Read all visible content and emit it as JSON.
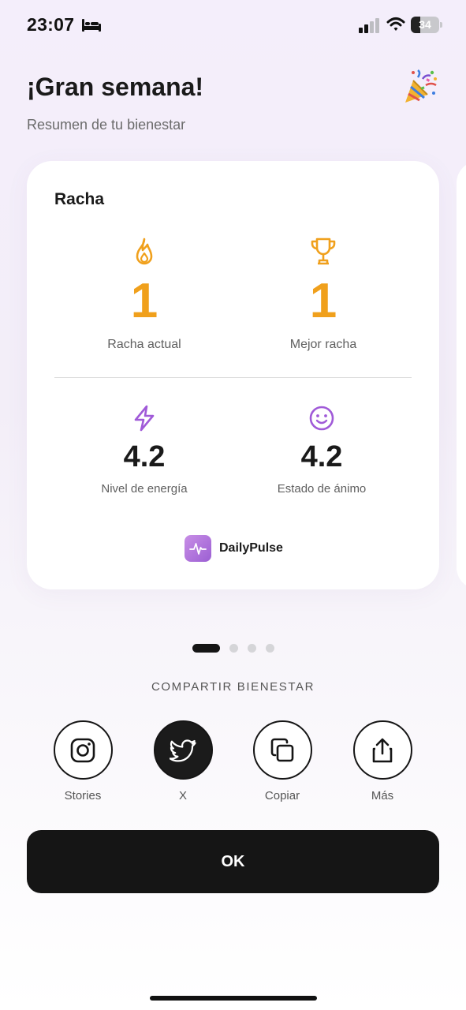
{
  "status_bar": {
    "time": "23:07",
    "battery_level": "34",
    "battery_fraction": 0.34,
    "icons": [
      "bed-icon",
      "signal-icon",
      "wifi-icon",
      "battery-icon"
    ]
  },
  "header": {
    "title": "¡Gran semana!",
    "subtitle": "Resumen de tu bienestar",
    "icon": "party-popper-icon"
  },
  "card": {
    "title": "Racha",
    "stats": [
      {
        "icon": "flame-icon",
        "value": "1",
        "label": "Racha actual"
      },
      {
        "icon": "trophy-icon",
        "value": "1",
        "label": "Mejor racha"
      },
      {
        "icon": "lightning-icon",
        "value": "4.2",
        "label": "Nivel de energía"
      },
      {
        "icon": "smiley-icon",
        "value": "4.2",
        "label": "Estado de ánimo"
      }
    ],
    "brand": {
      "name": "DailyPulse",
      "icon": "pulse-icon"
    }
  },
  "pagination": {
    "total": 4,
    "active": 0
  },
  "share": {
    "heading": "COMPARTIR BIENESTAR",
    "items": [
      {
        "label": "Stories",
        "icon": "instagram-icon"
      },
      {
        "label": "X",
        "icon": "twitter-bird-icon"
      },
      {
        "label": "Copiar",
        "icon": "copy-icon"
      },
      {
        "label": "Más",
        "icon": "share-icon"
      }
    ]
  },
  "ok_button": {
    "label": "OK"
  },
  "colors": {
    "accent_orange": "#f0a01c",
    "accent_purple": "#9b5fd3",
    "dark": "#151515"
  }
}
